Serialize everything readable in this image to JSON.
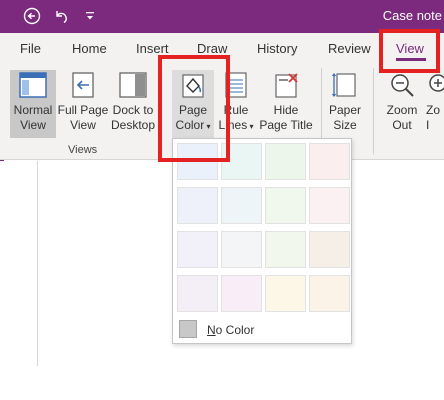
{
  "window": {
    "title": "Case note"
  },
  "titlebar": {
    "back_icon": "back-arrow-icon",
    "undo_icon": "undo-icon",
    "customize_icon": "customize-quick-access-icon"
  },
  "menu": {
    "tabs": [
      {
        "label": "File"
      },
      {
        "label": "Home"
      },
      {
        "label": "Insert"
      },
      {
        "label": "Draw"
      },
      {
        "label": "History"
      },
      {
        "label": "Review"
      },
      {
        "label": "View"
      }
    ],
    "active_tab": "View"
  },
  "ribbon": {
    "views": {
      "group_label": "Views",
      "normal_view": {
        "line1": "Normal",
        "line2": "View"
      },
      "full_page_view": {
        "line1": "Full Page",
        "line2": "View"
      },
      "dock_to_desktop": {
        "line1": "Dock to",
        "line2": "Desktop"
      }
    },
    "page_setup": {
      "page_color": {
        "line1": "Page",
        "line2": "Color"
      },
      "rule_lines": {
        "line1": "Rule",
        "line2": "Lines"
      },
      "hide_page_title": {
        "line1": "Hide",
        "line2": "Page Title"
      },
      "paper_size": {
        "line1": "Paper",
        "line2": "Size"
      }
    },
    "zoom": {
      "zoom_out": {
        "line1": "Zoom",
        "line2": "Out"
      },
      "zoom_in": {
        "line1": "Zo",
        "line2": "I"
      }
    }
  },
  "page_color_menu": {
    "swatches": [
      "#eaf1fb",
      "#eaf6f3",
      "#edf6ea",
      "#fbeeee",
      "#eef1fa",
      "#eef5f8",
      "#f0f8ee",
      "#fbf1f3",
      "#f2f0f8",
      "#f4f5f7",
      "#f2f7ee",
      "#f6efe7",
      "#f4eef6",
      "#f9eef7",
      "#fdf7e8",
      "#fbf3e7"
    ],
    "no_color": {
      "mnemonic": "N",
      "rest": "o Color"
    }
  },
  "colors": {
    "accent": "#7b2a7e",
    "highlight": "#e52222"
  }
}
